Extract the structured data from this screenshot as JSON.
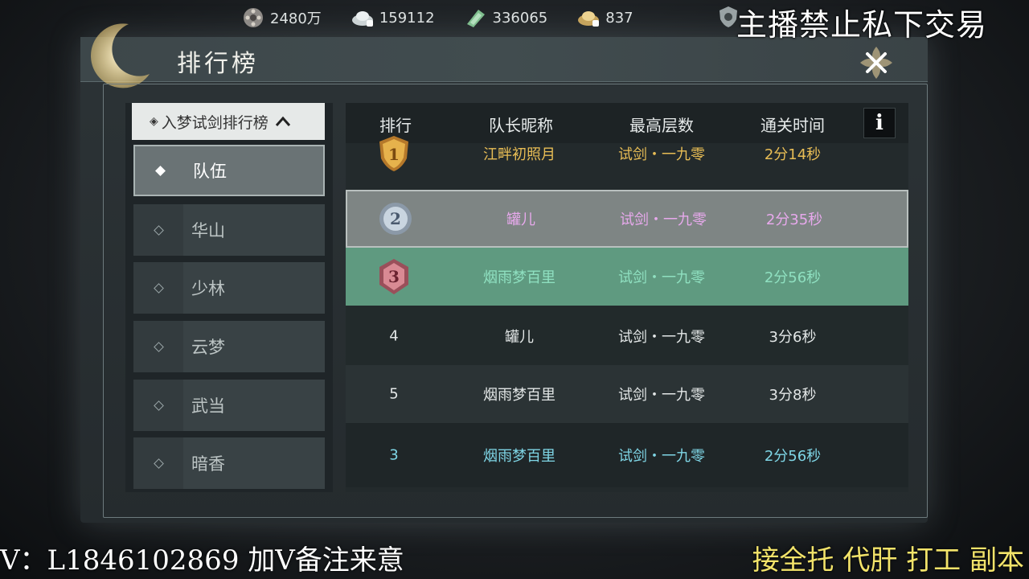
{
  "resources": [
    {
      "icon": "film-reel-icon",
      "value": "2480万"
    },
    {
      "icon": "silver-ingot-icon",
      "value": "159112"
    },
    {
      "icon": "jade-ticket-icon",
      "value": "336065"
    },
    {
      "icon": "gold-ingot-icon",
      "value": "837"
    }
  ],
  "overlay": {
    "top_right": "主播禁止私下交易",
    "bottom_left": "V：L1846102869 加V备注来意",
    "bottom_right": "接全托 代肝 打工 副本"
  },
  "panel": {
    "title": "排行榜",
    "close_icon": "close-icon"
  },
  "sidebar": {
    "dropdown_label": "入梦试剑排行榜",
    "dropdown_prefix": "◈",
    "dropdown_arrow": "^",
    "items": [
      {
        "label": "队伍",
        "active": true
      },
      {
        "label": "华山",
        "active": false
      },
      {
        "label": "少林",
        "active": false
      },
      {
        "label": "云梦",
        "active": false
      },
      {
        "label": "武当",
        "active": false
      },
      {
        "label": "暗香",
        "active": false
      }
    ]
  },
  "table": {
    "headers": [
      "排行",
      "队长昵称",
      "最高层数",
      "通关时间"
    ],
    "info_label": "i",
    "rows": [
      {
        "rank": "1",
        "name": "江畔初照月",
        "floor": "试剑・一九零",
        "time": "2分14秒"
      },
      {
        "rank": "2",
        "name": "罐儿",
        "floor": "试剑・一九零",
        "time": "2分35秒"
      },
      {
        "rank": "3",
        "name": "烟雨梦百里",
        "floor": "试剑・一九零",
        "time": "2分56秒"
      },
      {
        "rank": "4",
        "name": "罐儿",
        "floor": "试剑・一九零",
        "time": "3分6秒"
      },
      {
        "rank": "5",
        "name": "烟雨梦百里",
        "floor": "试剑・一九零",
        "time": "3分8秒"
      }
    ],
    "my_row": {
      "rank": "3",
      "name": "烟雨梦百里",
      "floor": "试剑・一九零",
      "time": "2分56秒"
    }
  },
  "colors": {
    "gold": "#e8bd55",
    "silver_row_text": "#e7a9ec",
    "bronze_row_bg": "#5f9a80",
    "my_row_text": "#7fd6e6"
  }
}
